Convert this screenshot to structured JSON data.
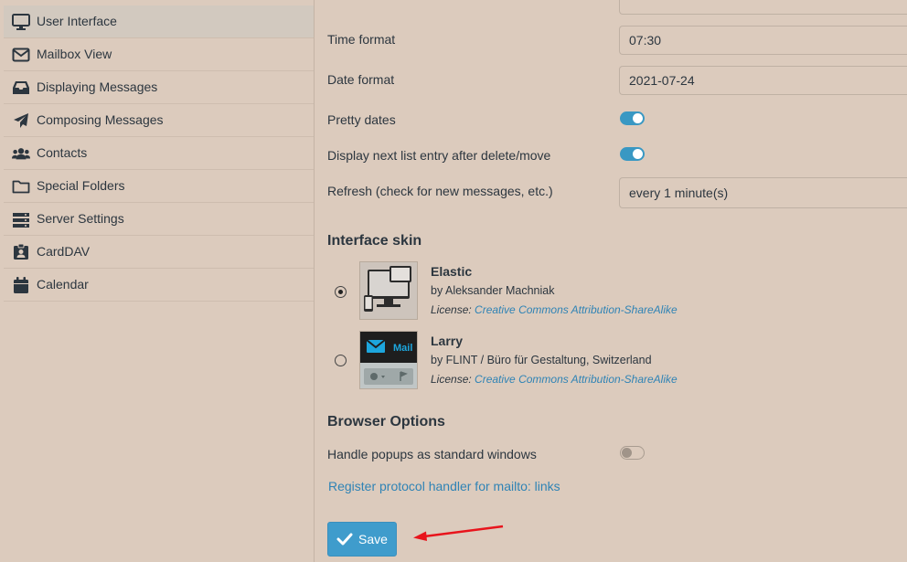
{
  "sidebar": {
    "items": [
      {
        "label": "User Interface",
        "icon": "monitor-icon",
        "active": true
      },
      {
        "label": "Mailbox View",
        "icon": "envelope-icon"
      },
      {
        "label": "Displaying Messages",
        "icon": "inbox-tray-icon"
      },
      {
        "label": "Composing Messages",
        "icon": "paper-plane-icon"
      },
      {
        "label": "Contacts",
        "icon": "users-icon"
      },
      {
        "label": "Special Folders",
        "icon": "folder-icon"
      },
      {
        "label": "Server Settings",
        "icon": "server-icon"
      },
      {
        "label": "CardDAV",
        "icon": "id-badge-icon"
      },
      {
        "label": "Calendar",
        "icon": "calendar-icon"
      }
    ]
  },
  "main": {
    "time_format": {
      "label": "Time format",
      "value": "07:30"
    },
    "date_format": {
      "label": "Date format",
      "value": "2021-07-24"
    },
    "pretty_dates": {
      "label": "Pretty dates",
      "enabled": true
    },
    "next_entry": {
      "label": "Display next list entry after delete/move",
      "enabled": true
    },
    "refresh": {
      "label": "Refresh (check for new messages, etc.)",
      "value": "every 1 minute(s)"
    },
    "skin_section_title": "Interface skin",
    "skins": [
      {
        "name": "Elastic",
        "author": "by Aleksander Machniak",
        "license_prefix": "License:",
        "license": "Creative Commons Attribution-ShareAlike",
        "selected": true
      },
      {
        "name": "Larry",
        "author": "by FLINT / Büro für Gestaltung, Switzerland",
        "license_prefix": "License:",
        "license": "Creative Commons Attribution-ShareAlike",
        "selected": false,
        "thumb_text": "Mail"
      }
    ],
    "browser_section_title": "Browser Options",
    "popups": {
      "label": "Handle popups as standard windows",
      "enabled": false
    },
    "protocol_link": "Register protocol handler for mailto: links",
    "save_label": "Save"
  },
  "colors": {
    "accent": "#3f9ccc",
    "background": "#dccbbd",
    "annotation_arrow": "#e8141c"
  }
}
